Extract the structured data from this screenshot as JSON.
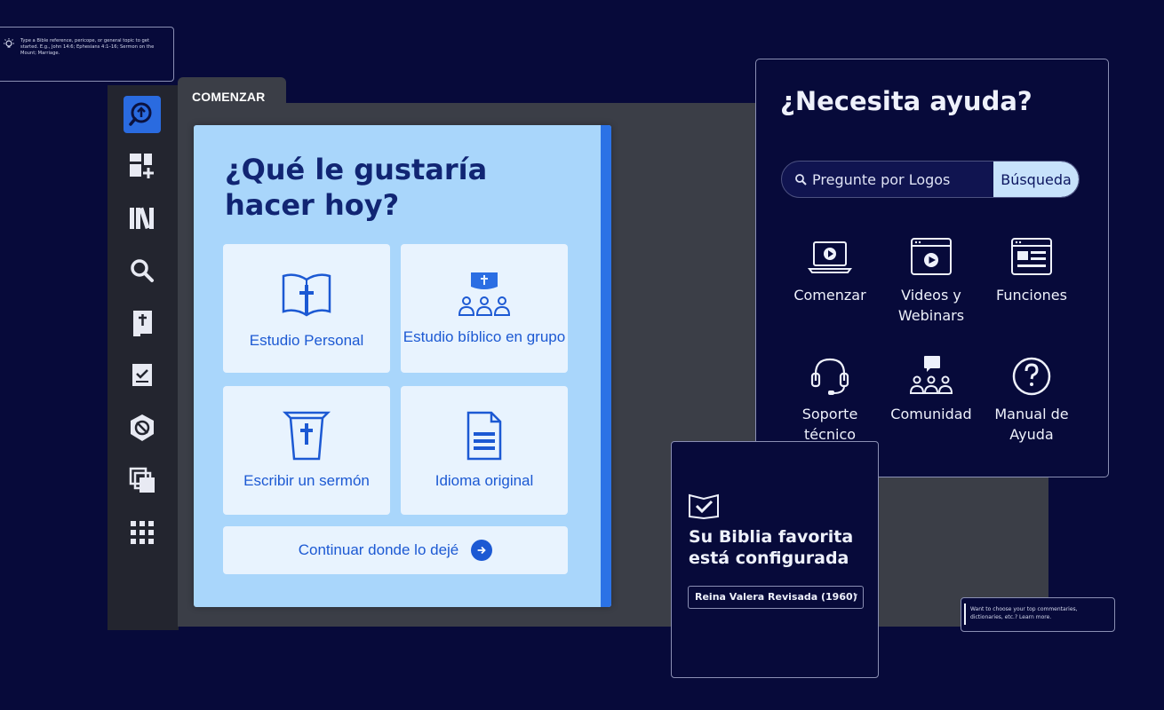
{
  "tip": {
    "text": "Type a Bible reference, pericope, or general topic to get started. E.g., John 14:6; Ephesians 4:1–16; Sermon on the Mount; Marriage."
  },
  "sidebar": {
    "items": [
      {
        "icon": "logos-icon",
        "active": true
      },
      {
        "icon": "add-layout-icon"
      },
      {
        "icon": "library-icon"
      },
      {
        "icon": "search-icon"
      },
      {
        "icon": "bible-icon"
      },
      {
        "icon": "checklist-icon"
      },
      {
        "icon": "shield-icon"
      },
      {
        "icon": "copy-icon"
      },
      {
        "icon": "apps-grid-icon"
      }
    ]
  },
  "main": {
    "tab_label": "COMENZAR",
    "title": "¿Qué le gustaría hacer hoy?",
    "options": [
      {
        "label": "Estudio Personal",
        "icon": "open-bible-icon"
      },
      {
        "label": "Estudio bíblico en grupo",
        "icon": "group-study-icon"
      },
      {
        "label": "Escribir un sermón",
        "icon": "pulpit-icon"
      },
      {
        "label": "Idioma original",
        "icon": "document-icon"
      }
    ],
    "continue_label": "Continuar donde lo dejé"
  },
  "help": {
    "title": "¿Necesita ayuda?",
    "search_placeholder": "Pregunte por Logos",
    "search_button": "Búsqueda",
    "items": [
      {
        "label": "Comenzar",
        "icon": "laptop-play-icon"
      },
      {
        "label": "Videos y Webinars",
        "icon": "video-window-icon"
      },
      {
        "label": "Funciones",
        "icon": "features-window-icon"
      },
      {
        "label": "Soporte técnico",
        "icon": "headset-icon"
      },
      {
        "label": "Comunidad",
        "icon": "community-icon"
      },
      {
        "label": "Manual de Ayuda",
        "icon": "help-circle-icon"
      }
    ]
  },
  "favorite": {
    "title": "Su Biblia favorita está configurada",
    "selected_bible": "Reina Valera Revisada (1960)"
  },
  "tip2": {
    "text": "Want to choose your top commentaries, dictionaries, etc.? Learn more."
  },
  "colors": {
    "background": "#070a3a",
    "accent": "#1c59d3",
    "card": "#a9d6fb",
    "title": "#112573"
  }
}
